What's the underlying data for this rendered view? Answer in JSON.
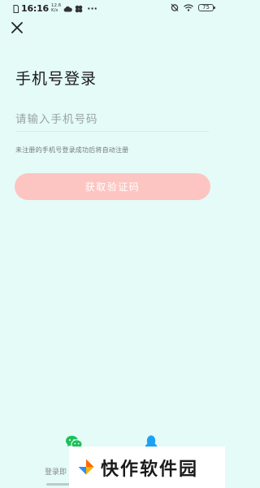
{
  "status_bar": {
    "time": "16:16",
    "net_speed_value": "12.6",
    "net_speed_unit": "K/s",
    "more": "···",
    "battery": "75"
  },
  "page": {
    "title": "手机号登录",
    "phone_placeholder": "请输入手机号码",
    "hint": "未注册的手机号登录成功后将自动注册",
    "get_code_button": "获取验证码"
  },
  "footer": {
    "other_login_text": "登录即"
  },
  "watermark": {
    "text": "快作软件园"
  },
  "colors": {
    "background": "#e4fbf8",
    "button_disabled": "#fdc5c1",
    "wechat_green": "#1ec05a",
    "qq_blue": "#1ea1f2",
    "logo_orange": "#ff6a00"
  },
  "icons": {
    "close": "close-icon",
    "wechat": "wechat-icon",
    "qq": "qq-icon",
    "wifi": "wifi-icon",
    "alarm": "alarm-icon",
    "sim": "sim-icon",
    "cloud": "cloud-icon",
    "fan": "fan-icon"
  }
}
